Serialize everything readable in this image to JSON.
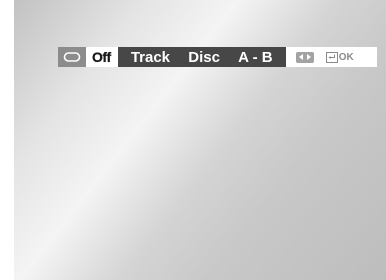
{
  "osd": {
    "repeat_icon": "repeat-icon",
    "current_mode": "Off",
    "modes": [
      "Track",
      "Disc",
      "A - B"
    ],
    "nav_icon": "left-right-arrows-icon",
    "enter_icon": "enter-icon",
    "ok_label": "OK"
  },
  "colors": {
    "bar_background": "#ffffff",
    "modes_background": "#474747",
    "icon_gray": "#8c8c8c"
  }
}
